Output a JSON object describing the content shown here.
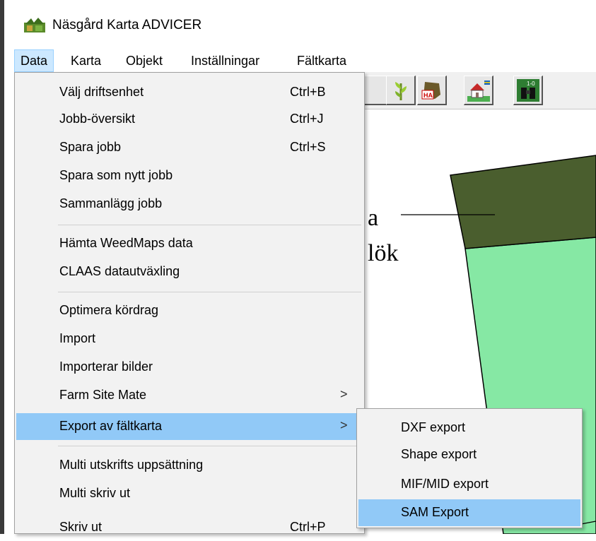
{
  "window": {
    "title": "Näsgård Karta ADVICER",
    "icon": "app-logo-icon"
  },
  "menubar": {
    "items": [
      {
        "label": "Data"
      },
      {
        "label": "Karta"
      },
      {
        "label": "Objekt"
      },
      {
        "label": "Inställningar"
      },
      {
        "label": "Fältkarta"
      }
    ]
  },
  "toolbar": {
    "buttons": [
      {
        "icon": "plant-icon"
      },
      {
        "icon": "field-area-icon",
        "text": "HA"
      },
      {
        "icon": "farm-house-icon"
      },
      {
        "icon": "binoculars-icon",
        "text": "1-0"
      }
    ]
  },
  "map": {
    "label_line1": "a",
    "label_line2": "lök",
    "colors": {
      "dark_field": "#4a5e2e",
      "light_field": "#86e8a4"
    }
  },
  "data_menu": {
    "items": [
      {
        "label": "Välj driftsenhet",
        "shortcut": "Ctrl+B"
      },
      {
        "label": "Jobb-översikt",
        "shortcut": "Ctrl+J"
      },
      {
        "label": "Spara jobb",
        "shortcut": "Ctrl+S"
      },
      {
        "label": "Spara som nytt jobb",
        "shortcut": ""
      },
      {
        "label": "Sammanlägg jobb",
        "shortcut": ""
      },
      {
        "label": "Hämta WeedMaps data",
        "shortcut": ""
      },
      {
        "label": "CLAAS datautväxling",
        "shortcut": ""
      },
      {
        "label": "Optimera kördrag",
        "shortcut": ""
      },
      {
        "label": "Import",
        "shortcut": ""
      },
      {
        "label": "Importerar bilder",
        "shortcut": ""
      },
      {
        "label": "Farm Site Mate",
        "shortcut": "",
        "submenu_arrow": ">"
      },
      {
        "label": "Export av fältkarta",
        "shortcut": "",
        "submenu_arrow": ">"
      },
      {
        "label": "Multi utskrifts uppsättning",
        "shortcut": ""
      },
      {
        "label": "Multi skriv ut",
        "shortcut": ""
      },
      {
        "label": "Skriv ut",
        "shortcut": "Ctrl+P"
      }
    ]
  },
  "export_submenu": {
    "items": [
      {
        "label": "DXF export"
      },
      {
        "label": "Shape export"
      },
      {
        "label": "MIF/MID export"
      },
      {
        "label": "SAM Export"
      }
    ]
  },
  "colors": {
    "menu_highlight": "#91c9f7",
    "menubar_active": "#cce8ff",
    "menu_background": "#f2f2f2"
  }
}
